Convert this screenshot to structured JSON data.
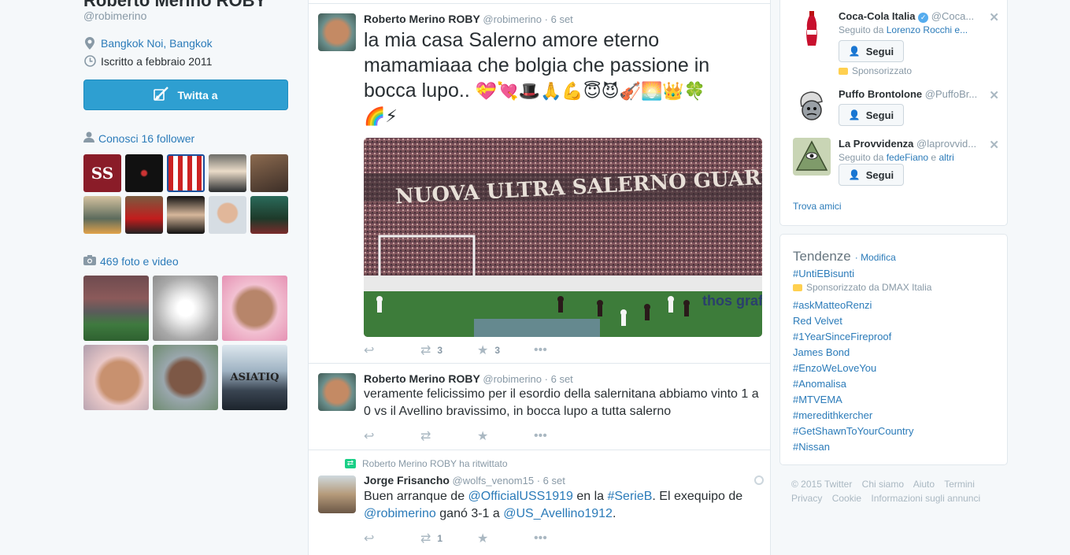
{
  "profile": {
    "name": "Roberto Merino ROBY",
    "handle": "@robimerino",
    "location": "Bangkok Noi, Bangkok",
    "joined": "Iscritto a febbraio 2011",
    "tweet_to_label": "Twitta a",
    "followers_known": "Conosci 16 follower",
    "media_count": "469 foto e video"
  },
  "tweets": [
    {
      "fullname": "Roberto Merino ROBY",
      "username": "@robimerino",
      "time": "· 6 set",
      "text_line1": "la mia casa Salerno amore eterno",
      "text_line2": "mamamiaaa che bolgia che passione in",
      "text_line3": "bocca lupo..",
      "emoji_line1": "💝💘🎩🙏💪😇😈🎻🌅👑🍀",
      "emoji_line2": "🌈⚡",
      "retweets": "3",
      "favorites": "3",
      "photo_banner": "NUOVA ULTRA SALERNO GUARDIA",
      "photo_ad": "thos grafic"
    },
    {
      "fullname": "Roberto Merino ROBY",
      "username": "@robimerino",
      "time": "· 6 set",
      "text_line1": "veramente felicissimo per il esordio della salernitana abbiamo vinto 1 a",
      "text_line2": "0 vs il Avellino bravissimo, in bocca lupo a tutta salerno"
    },
    {
      "retweet_context": "Roberto Merino ROBY ha ritwittato",
      "fullname": "Jorge Frisancho",
      "username": "@wolfs_venom15",
      "time": "· 6 set",
      "p1": "Buen arranque de ",
      "m1": "@OfficialUSS1919",
      "p2": " en la ",
      "m2": "#SerieB",
      "p3": ". El exequipo de",
      "m3": "@robimerino",
      "p4": " ganó 3-1 a ",
      "m4": "@US_Avellino1912",
      "p5": ".",
      "retweets": "1"
    }
  ],
  "who_to_follow": [
    {
      "name": "Coca-Cola Italia",
      "handle": "@Coca...",
      "sub_prefix": "Seguito da ",
      "sub_link": "Lorenzo Rocchi e...",
      "follow": "Segui",
      "sponsored": "Sponsorizzato"
    },
    {
      "name": "Puffo Brontolone",
      "handle": "@PuffoBr...",
      "follow": "Segui"
    },
    {
      "name": "La Provvidenza",
      "handle": "@laprovvid...",
      "sub_prefix": "Seguito da ",
      "sub_link": "fedeFiano",
      "sub_mid": " e ",
      "sub_link2": "altri",
      "follow": "Segui"
    }
  ],
  "find_friends": "Trova amici",
  "trends": {
    "title": "Tendenze",
    "edit": "· Modifica",
    "promoted_by": "Sponsorizzato da DMAX Italia",
    "items": [
      "#UntiEBisunti",
      "#askMatteoRenzi",
      "Red Velvet",
      "#1YearSinceFireproof",
      "James Bond",
      "#EnzoWeLoveYou",
      "#Anomalisa",
      "#MTVEMA",
      "#meredithkercher",
      "#GetShawnToYourCountry",
      "#Nissan"
    ]
  },
  "footer": {
    "copyright": "© 2015 Twitter",
    "about": "Chi siamo",
    "help": "Aiuto",
    "terms": "Termini",
    "privacy": "Privacy",
    "cookie": "Cookie",
    "ads": "Informazioni sugli annunci"
  },
  "colors": {
    "link": "#2b7bb9",
    "button": "#2e9fd1",
    "muted": "#8899a6"
  }
}
